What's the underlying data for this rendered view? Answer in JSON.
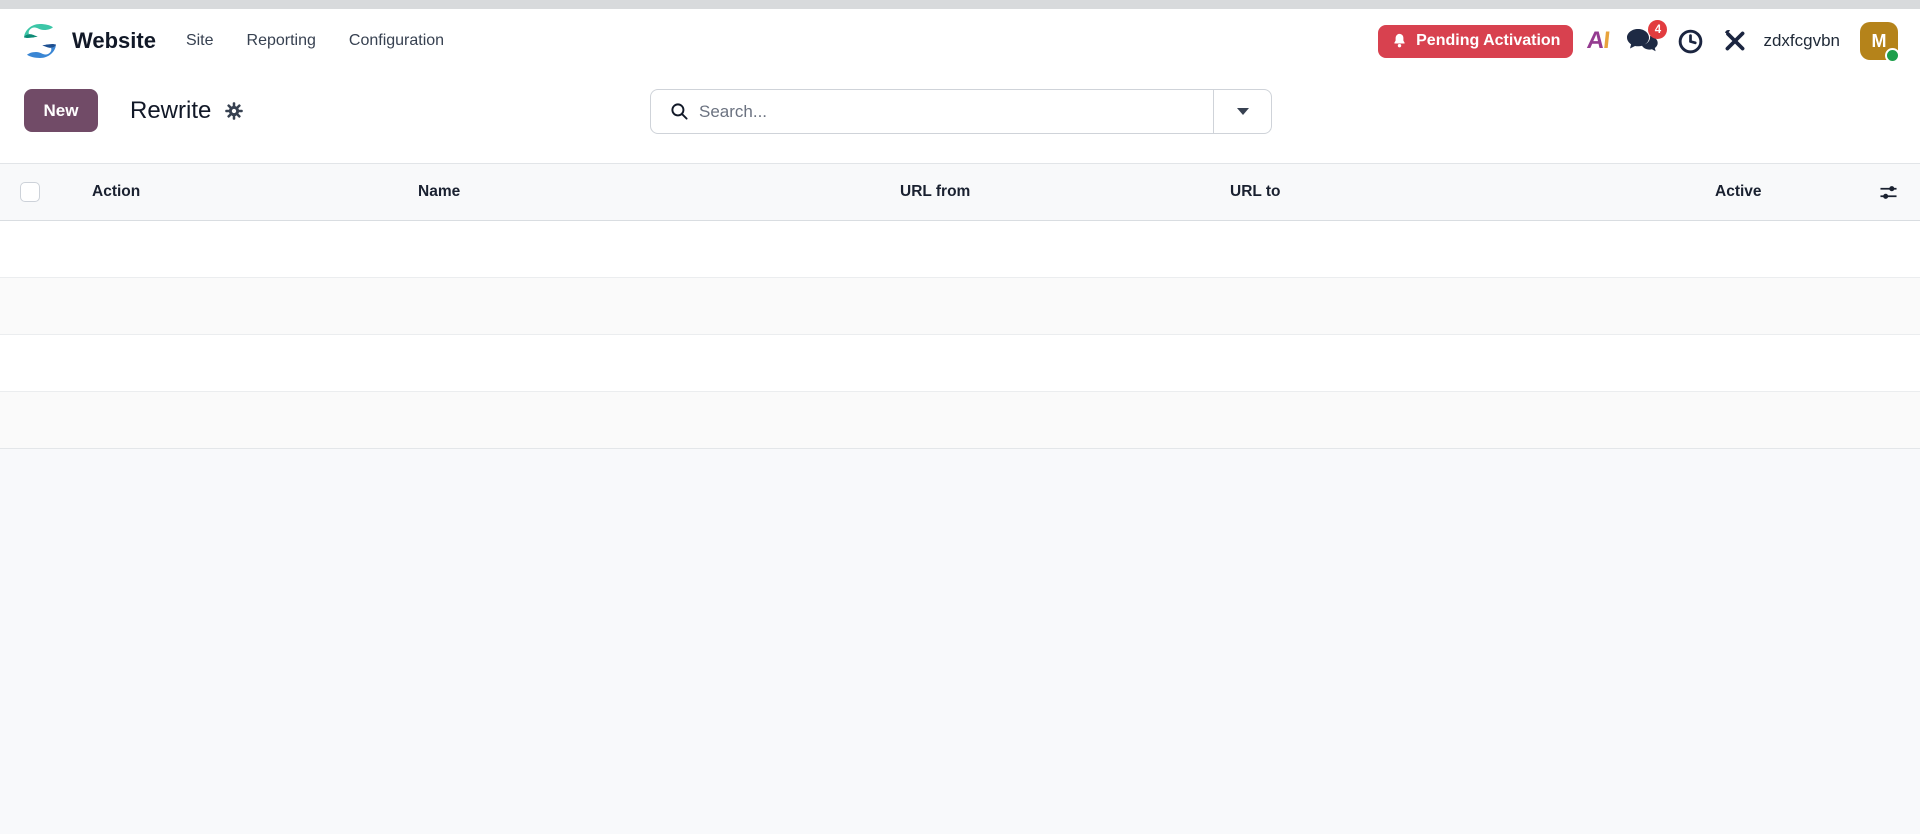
{
  "topbar": {
    "app_name": "Website",
    "menu_items": [
      {
        "label": "Site"
      },
      {
        "label": "Reporting"
      },
      {
        "label": "Configuration"
      }
    ],
    "pending_activation_label": "Pending Activation",
    "message_badge_count": "4",
    "username": "zdxfcgvbn",
    "avatar_initial": "M",
    "icons": [
      "website-logo",
      "bell-icon",
      "ai-icon",
      "messages-icon",
      "activities-clock-icon",
      "tools-icon"
    ]
  },
  "control_panel": {
    "new_button_label": "New",
    "view_title": "Rewrite",
    "icons": [
      "gear-icon",
      "search-icon",
      "caret-down-icon"
    ],
    "search": {
      "placeholder": "Search...",
      "value": ""
    }
  },
  "table": {
    "columns": [
      "Action",
      "Name",
      "URL from",
      "URL to",
      "Active"
    ],
    "header_icons": [
      "select-all-checkbox",
      "optional-columns-sliders-icon"
    ],
    "rows": [
      {},
      {},
      {},
      {}
    ]
  },
  "colors": {
    "accent": "#714B67",
    "danger": "#d8414f",
    "avatar_bg": "#b5831a",
    "online_dot": "#1c9e4b",
    "ai_a": "#943b90",
    "ai_i": "#e8a33d",
    "logo_teal": "#3cc6a7",
    "logo_teal_dark": "#0d8b76",
    "logo_blue": "#3a86d4",
    "logo_blue_dark": "#1d4f91",
    "header_bg": "#f8f9fa",
    "page_bg": "#f8f9fb"
  }
}
